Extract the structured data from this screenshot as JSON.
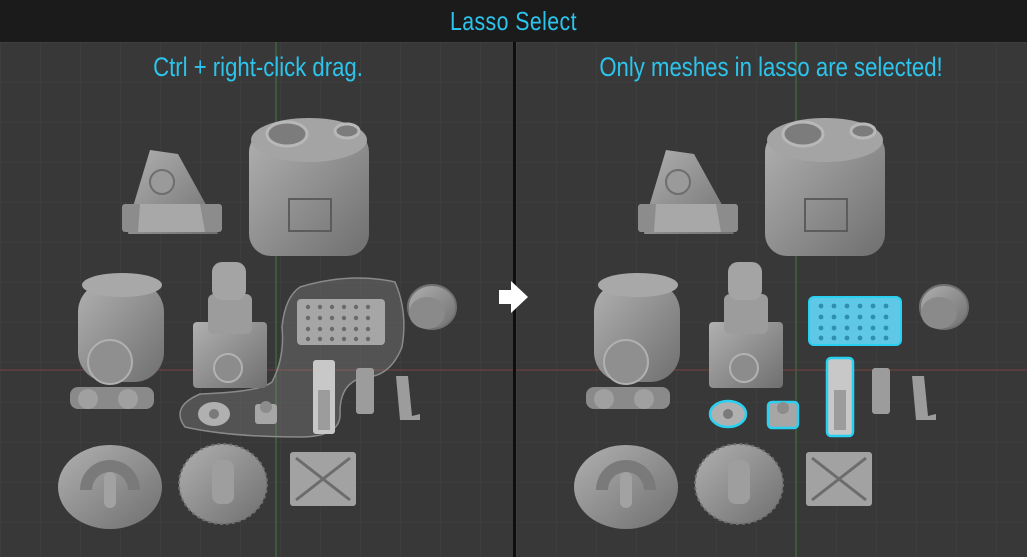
{
  "header": {
    "title": "Lasso Select"
  },
  "panels": {
    "left_caption": "Ctrl + right-click drag.",
    "right_caption": "Only meshes in lasso are selected!"
  },
  "colors": {
    "accent": "#2cc4ec",
    "selection_outline": "#2ad0f0",
    "viewport_bg": "#3a3a3a",
    "mesh": "#8e8e8e"
  },
  "icons": {
    "transition": "arrow-right-icon"
  }
}
